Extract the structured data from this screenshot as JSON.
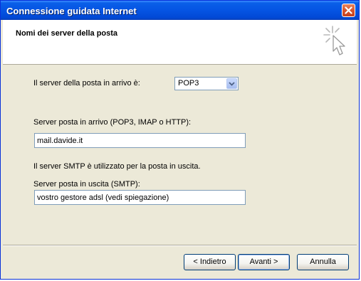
{
  "window": {
    "title": "Connessione guidata Internet"
  },
  "header": {
    "heading": "Nomi dei server della posta"
  },
  "form": {
    "incoming_type_label": "Il server della posta in arrivo è:",
    "incoming_type_value": "POP3",
    "incoming_server_label": "Server posta in arrivo (POP3, IMAP o HTTP):",
    "incoming_server_value": "mail.davide.it",
    "smtp_info": "Il server SMTP è utilizzato per la posta in uscita.",
    "outgoing_server_label": "Server posta in uscita (SMTP):",
    "outgoing_server_value": "vostro gestore adsl (vedi spiegazione)"
  },
  "buttons": {
    "back": "< Indietro",
    "next": "Avanti >",
    "cancel": "Annulla"
  },
  "icons": {
    "close": "close-icon",
    "wizard": "wizard-cursor-icon",
    "dropdown": "chevron-down-icon"
  },
  "colors": {
    "titlebar": "#0554e3",
    "window_bg": "#ece9d8",
    "close": "#d9542d"
  }
}
